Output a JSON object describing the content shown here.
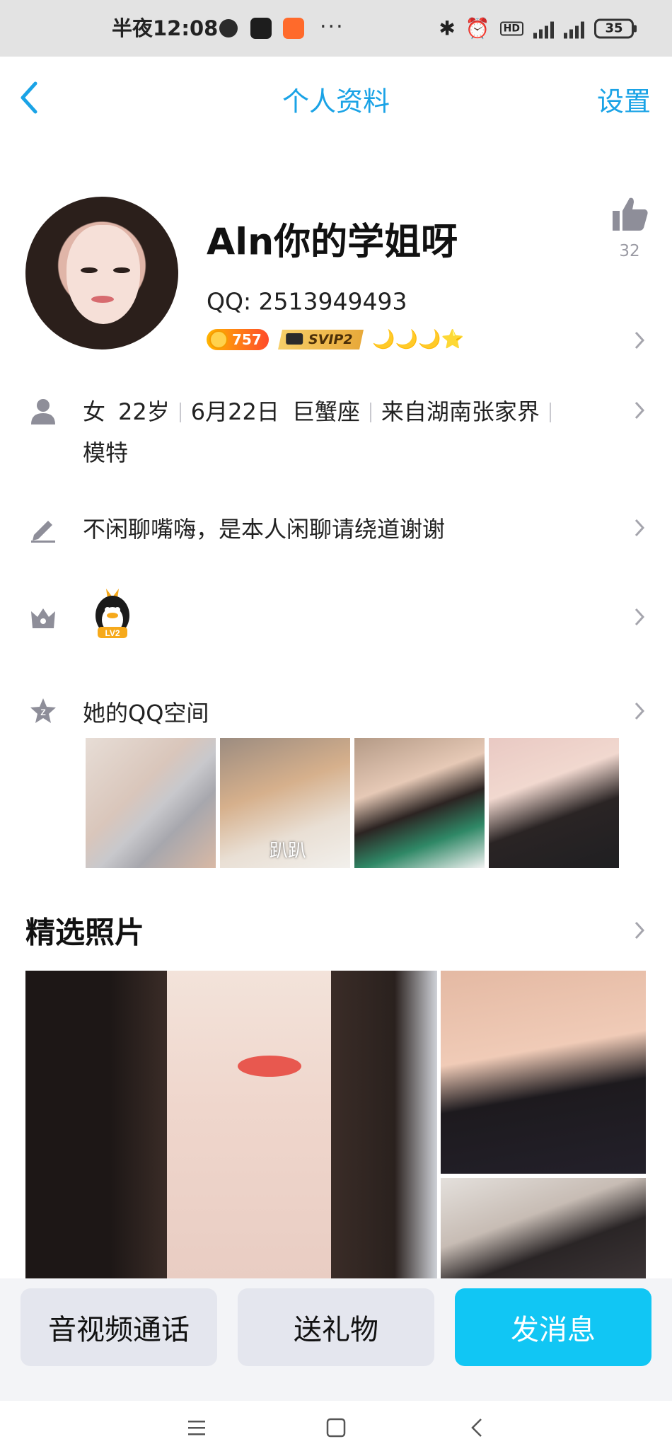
{
  "status_bar": {
    "time": "半夜12:08",
    "dots": "···",
    "network": "4G",
    "hd": "HD",
    "battery": "35"
  },
  "nav": {
    "title": "个人资料",
    "settings": "设置"
  },
  "profile": {
    "nickname": "Aln你的学姐呀",
    "qq_number": "QQ: 2513949493",
    "coin_badge": "757",
    "svip_badge": "SVIP2",
    "level_icons": "🌙🌙🌙⭐",
    "likes": "32"
  },
  "info": {
    "gender": "女",
    "age": "22岁",
    "birthday": "6月22日",
    "zodiac": "巨蟹座",
    "hometown": "来自湖南张家界",
    "occupation": "模特"
  },
  "signature": "不闲聊嘴嗨，是本人闲聊请绕道谢谢",
  "medal": {
    "label": "LV2"
  },
  "qzone": {
    "label": "她的QQ空间",
    "thumb_caption": "趴趴"
  },
  "photos": {
    "section_title": "精选照片"
  },
  "actions": {
    "call": "音视频通话",
    "gift": "送礼物",
    "message": "发消息"
  },
  "colors": {
    "accent": "#1aa3e6",
    "message_button": "#11c6f4",
    "icon_gray": "#8e8e99"
  }
}
